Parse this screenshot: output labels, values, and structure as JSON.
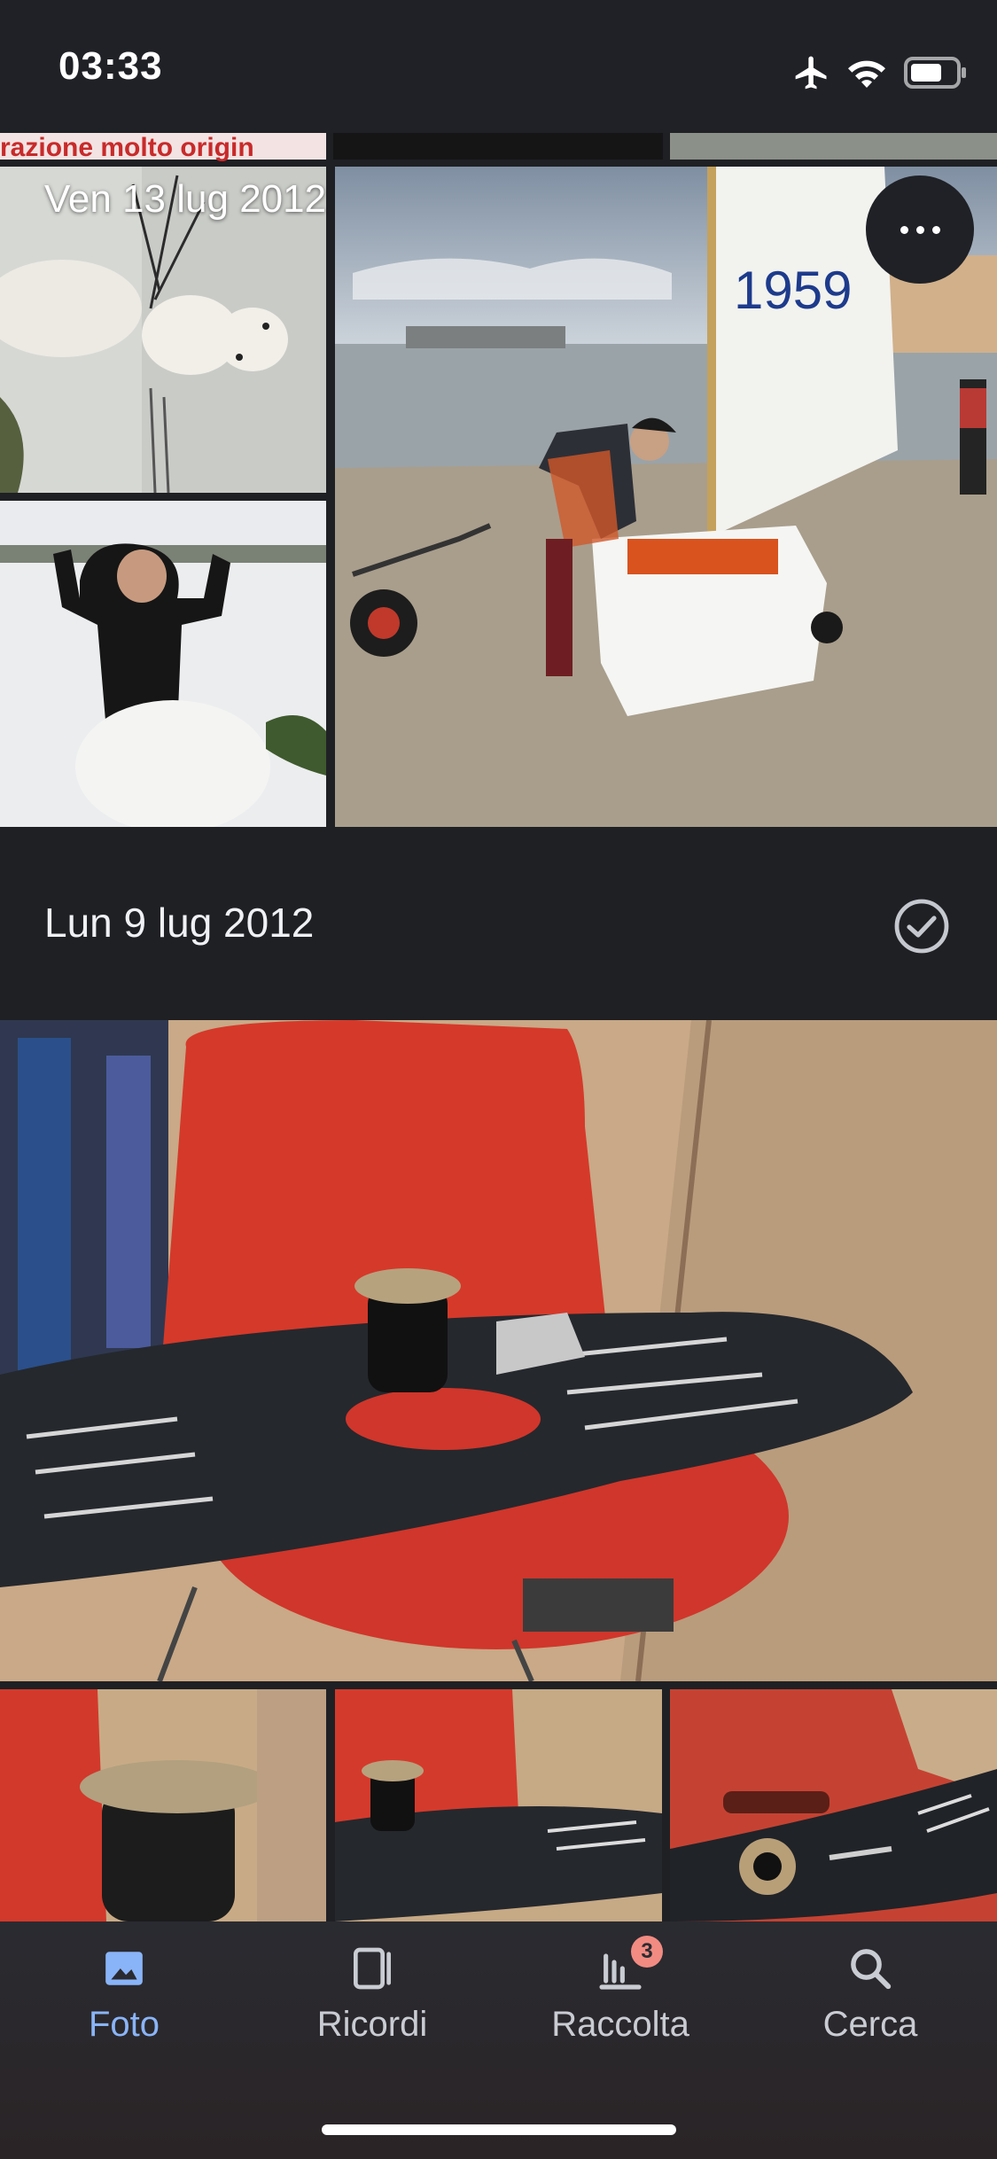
{
  "status_bar": {
    "time": "03:33",
    "icons": [
      "airplane-mode-icon",
      "wifi-icon",
      "battery-icon"
    ]
  },
  "groups": [
    {
      "overlay_date": "Ven 13 lug 2012",
      "strip_caption": "razione molto origin"
    },
    {
      "date": "Lun 9 lug 2012"
    }
  ],
  "actions": {
    "more_icon": "more-horizontal-icon",
    "select_icon": "check-circle-icon"
  },
  "bottom_nav": {
    "items": [
      {
        "label": "Foto",
        "icon": "photo-icon",
        "active": true
      },
      {
        "label": "Ricordi",
        "icon": "memories-icon",
        "active": false
      },
      {
        "label": "Raccolta",
        "icon": "library-icon",
        "badge": "3",
        "active": false
      },
      {
        "label": "Cerca",
        "icon": "search-icon",
        "active": false
      }
    ]
  },
  "colors": {
    "background": "#1f2024",
    "accent": "#8ab4f8",
    "badge": "#f28b82"
  }
}
